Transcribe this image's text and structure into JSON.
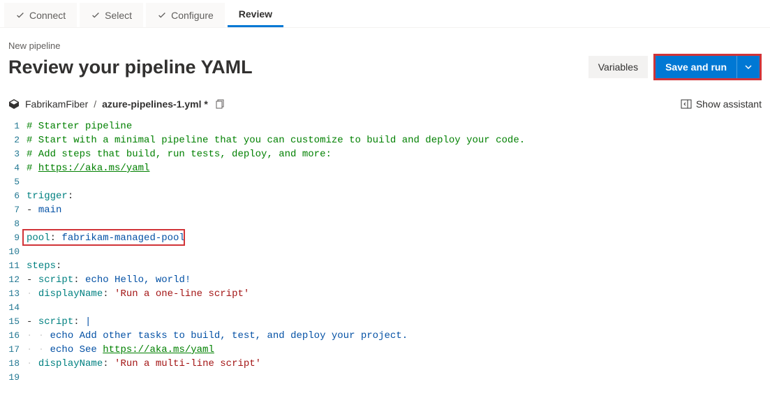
{
  "wizard": {
    "steps": [
      {
        "label": "Connect",
        "state": "done"
      },
      {
        "label": "Select",
        "state": "done"
      },
      {
        "label": "Configure",
        "state": "done"
      },
      {
        "label": "Review",
        "state": "active"
      }
    ]
  },
  "header": {
    "crumb": "New pipeline",
    "title": "Review your pipeline YAML",
    "variables_label": "Variables",
    "save_run_label": "Save and run"
  },
  "subheader": {
    "repo": "FabrikamFiber",
    "separator": "/",
    "filename": "azure-pipelines-1.yml *",
    "show_assistant": "Show assistant"
  },
  "editor": {
    "lines": [
      {
        "n": 1,
        "tokens": [
          {
            "t": "# Starter pipeline",
            "c": "cm-comment"
          }
        ]
      },
      {
        "n": 2,
        "tokens": [
          {
            "t": "# Start with a minimal pipeline that you can customize to build and deploy your code.",
            "c": "cm-comment"
          }
        ]
      },
      {
        "n": 3,
        "tokens": [
          {
            "t": "# Add steps that build, run tests, deploy, and more:",
            "c": "cm-comment"
          }
        ]
      },
      {
        "n": 4,
        "tokens": [
          {
            "t": "# ",
            "c": "cm-comment"
          },
          {
            "t": "https://aka.ms/yaml",
            "c": "cm-link"
          }
        ]
      },
      {
        "n": 5,
        "tokens": []
      },
      {
        "n": 6,
        "tokens": [
          {
            "t": "trigger",
            "c": "cm-key"
          },
          {
            "t": ":",
            "c": ""
          }
        ]
      },
      {
        "n": 7,
        "tokens": [
          {
            "t": "- ",
            "c": "cm-dash"
          },
          {
            "t": "main",
            "c": "cm-string"
          }
        ]
      },
      {
        "n": 8,
        "tokens": []
      },
      {
        "n": 9,
        "tokens": [
          {
            "t": "pool",
            "c": "cm-key"
          },
          {
            "t": ": ",
            "c": ""
          },
          {
            "t": "fabrikam-managed-pool",
            "c": "cm-string"
          }
        ]
      },
      {
        "n": 10,
        "tokens": []
      },
      {
        "n": 11,
        "tokens": [
          {
            "t": "steps",
            "c": "cm-key"
          },
          {
            "t": ":",
            "c": ""
          }
        ]
      },
      {
        "n": 12,
        "tokens": [
          {
            "t": "- ",
            "c": "cm-dash"
          },
          {
            "t": "script",
            "c": "cm-key"
          },
          {
            "t": ": ",
            "c": ""
          },
          {
            "t": "echo Hello, world!",
            "c": "cm-string"
          }
        ]
      },
      {
        "n": 13,
        "tokens": [
          {
            "t": "· ",
            "c": "indent-guide"
          },
          {
            "t": "displayName",
            "c": "cm-key"
          },
          {
            "t": ": ",
            "c": ""
          },
          {
            "t": "'Run a one-line script'",
            "c": "cm-sq"
          }
        ]
      },
      {
        "n": 14,
        "tokens": []
      },
      {
        "n": 15,
        "tokens": [
          {
            "t": "- ",
            "c": "cm-dash"
          },
          {
            "t": "script",
            "c": "cm-key"
          },
          {
            "t": ": ",
            "c": ""
          },
          {
            "t": "|",
            "c": "cm-pipe"
          }
        ]
      },
      {
        "n": 16,
        "tokens": [
          {
            "t": "· · ",
            "c": "indent-guide"
          },
          {
            "t": "echo Add other tasks to build, test, and deploy your project.",
            "c": "cm-string"
          }
        ]
      },
      {
        "n": 17,
        "tokens": [
          {
            "t": "· · ",
            "c": "indent-guide"
          },
          {
            "t": "echo See ",
            "c": "cm-string"
          },
          {
            "t": "https://aka.ms/yaml",
            "c": "cm-link"
          }
        ]
      },
      {
        "n": 18,
        "tokens": [
          {
            "t": "· ",
            "c": "indent-guide"
          },
          {
            "t": "displayName",
            "c": "cm-key"
          },
          {
            "t": ": ",
            "c": ""
          },
          {
            "t": "'Run a multi-line script'",
            "c": "cm-sq"
          }
        ]
      },
      {
        "n": 19,
        "tokens": []
      }
    ],
    "highlight_line": 9
  }
}
